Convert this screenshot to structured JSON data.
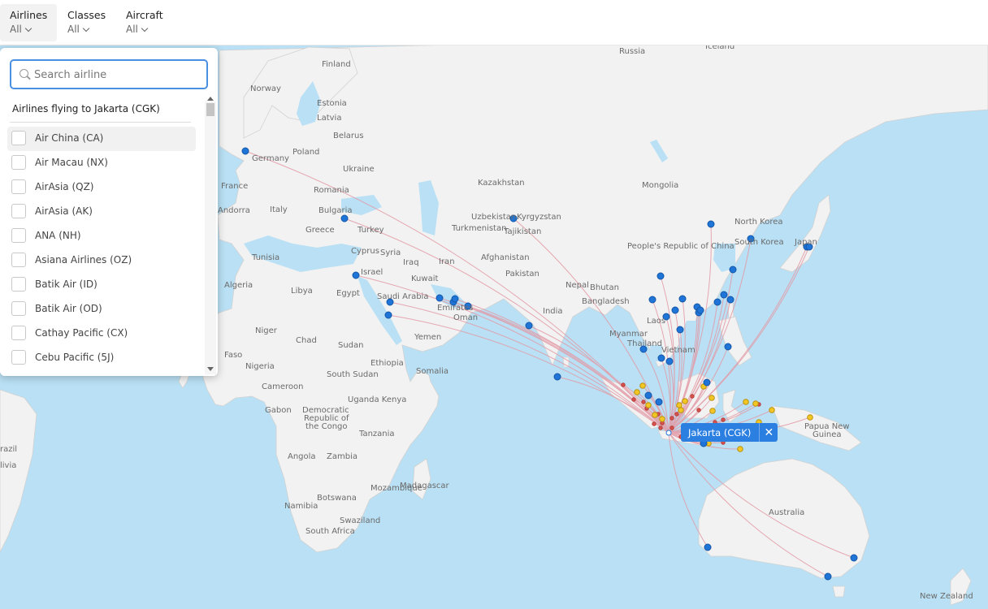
{
  "filters": [
    {
      "label": "Airlines",
      "value": "All"
    },
    {
      "label": "Classes",
      "value": "All"
    },
    {
      "label": "Aircraft",
      "value": "All"
    }
  ],
  "dropdown": {
    "search_placeholder": "Search airline",
    "heading": "Airlines flying to Jakarta (CGK)",
    "airlines": [
      "Air China (CA)",
      "Air Macau (NX)",
      "AirAsia (QZ)",
      "AirAsia (AK)",
      "ANA (NH)",
      "Asiana Airlines (OZ)",
      "Batik Air (ID)",
      "Batik Air (OD)",
      "Cathay Pacific (CX)",
      "Cebu Pacific (5J)"
    ]
  },
  "popup": {
    "label": "Jakarta (CGK)",
    "close": "✕"
  },
  "map_labels": {
    "iceland": "Iceland",
    "russia": "Russia",
    "finland": "Finland",
    "norway": "Norway",
    "estonia": "Estonia",
    "latvia": "Latvia",
    "belarus": "Belarus",
    "poland": "Poland",
    "germany": "Germany",
    "ukraine": "Ukraine",
    "france": "France",
    "andorra": "Andorra",
    "romania": "Romania",
    "italy": "Italy",
    "bulgaria": "Bulgaria",
    "greece": "Greece",
    "turkey": "Turkey",
    "kazakhstan": "Kazakhstan",
    "mongolia": "Mongolia",
    "uzbekistan": "Uzbekistan",
    "kyrgyzstan": "Kyrgyzstan",
    "turkmenistan": "Turkmenistan",
    "tajikistan": "Tajikistan",
    "north_korea": "North Korea",
    "south_korea": "South Korea",
    "japan": "Japan",
    "china": "People's Republic of China",
    "tunisia": "Tunisia",
    "cyprus": "Cyprus",
    "syria": "Syria",
    "iraq": "Iraq",
    "iran": "Iran",
    "afghanistan": "Afghanistan",
    "pakistan": "Pakistan",
    "nepal": "Nepal",
    "bhutan": "Bhutan",
    "israel": "Israel",
    "kuwait": "Kuwait",
    "algeria": "Algeria",
    "libya": "Libya",
    "egypt": "Egypt",
    "saudi_arabia": "Saudi Arabia",
    "emirates": "Emirates",
    "oman": "Oman",
    "india": "India",
    "bangladesh": "Bangladesh",
    "myanmar": "Myanmar",
    "laos": "Laos",
    "thailand": "Thailand",
    "vietnam": "Vietnam",
    "niger": "Niger",
    "chad": "Chad",
    "sudan": "Sudan",
    "yemen": "Yemen",
    "burkina_faso": "Faso",
    "nigeria": "Nigeria",
    "ethiopia": "Ethiopia",
    "south_sudan": "South Sudan",
    "somalia": "Somalia",
    "cameroon": "Cameroon",
    "gabon": "Gabon",
    "uganda_kenya": "Uganda Kenya",
    "drc1": "Democratic",
    "drc2": "Republic of",
    "drc3": "the Congo",
    "tanzania": "Tanzania",
    "angola": "Angola",
    "zambia": "Zambia",
    "mozambique": "Mozambique",
    "madagascar": "Madagascar",
    "namibia": "Namibia",
    "botswana": "Botswana",
    "south_africa": "South Africa",
    "eswatini": "Swaziland",
    "brazil": "razil",
    "livia": "livia",
    "png1": "Papua New",
    "png2": "Guinea",
    "australia": "Australia",
    "new_zealand": "New Zealand"
  }
}
